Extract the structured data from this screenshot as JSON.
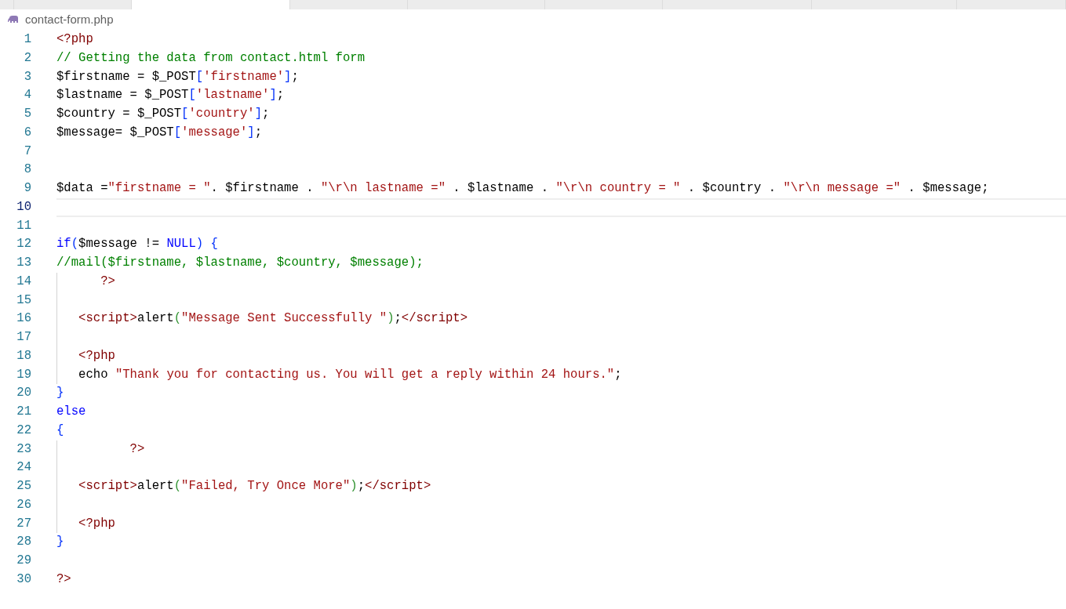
{
  "tabs": [
    {
      "selected": false
    },
    {
      "selected": false
    },
    {
      "selected": true
    },
    {
      "selected": false
    },
    {
      "selected": false
    },
    {
      "selected": false
    },
    {
      "selected": false
    },
    {
      "selected": false
    },
    {
      "selected": false
    }
  ],
  "breadcrumb": {
    "file": "contact-form.php"
  },
  "lines": [
    {
      "number": "1",
      "current": false,
      "guide": false,
      "tokens": [
        {
          "kind": "tag",
          "text": "<?php"
        }
      ]
    },
    {
      "number": "2",
      "current": false,
      "guide": false,
      "tokens": [
        {
          "kind": "comment",
          "text": "// Getting the data from contact.html form"
        }
      ]
    },
    {
      "number": "3",
      "current": false,
      "guide": false,
      "tokens": [
        {
          "kind": "plain",
          "text": "$firstname = $_POST"
        },
        {
          "kind": "bracket",
          "text": "["
        },
        {
          "kind": "string",
          "text": "'firstname'"
        },
        {
          "kind": "bracket",
          "text": "]"
        },
        {
          "kind": "plain",
          "text": ";"
        }
      ]
    },
    {
      "number": "4",
      "current": false,
      "guide": false,
      "tokens": [
        {
          "kind": "plain",
          "text": "$lastname = $_POST"
        },
        {
          "kind": "bracket",
          "text": "["
        },
        {
          "kind": "string",
          "text": "'lastname'"
        },
        {
          "kind": "bracket",
          "text": "]"
        },
        {
          "kind": "plain",
          "text": ";"
        }
      ]
    },
    {
      "number": "5",
      "current": false,
      "guide": false,
      "tokens": [
        {
          "kind": "plain",
          "text": "$country = $_POST"
        },
        {
          "kind": "bracket",
          "text": "["
        },
        {
          "kind": "string",
          "text": "'country'"
        },
        {
          "kind": "bracket",
          "text": "]"
        },
        {
          "kind": "plain",
          "text": ";"
        }
      ]
    },
    {
      "number": "6",
      "current": false,
      "guide": false,
      "tokens": [
        {
          "kind": "plain",
          "text": "$message= $_POST"
        },
        {
          "kind": "bracket",
          "text": "["
        },
        {
          "kind": "string",
          "text": "'message'"
        },
        {
          "kind": "bracket",
          "text": "]"
        },
        {
          "kind": "plain",
          "text": ";"
        }
      ]
    },
    {
      "number": "7",
      "current": false,
      "guide": false
    },
    {
      "number": "8",
      "current": false,
      "guide": false
    },
    {
      "number": "9",
      "current": false,
      "guide": false,
      "tokens": [
        {
          "kind": "plain",
          "text": "$data ="
        },
        {
          "kind": "string",
          "text": "\"firstname = \""
        },
        {
          "kind": "plain",
          "text": ". $firstname . "
        },
        {
          "kind": "string",
          "text": "\"\\r\\n lastname =\""
        },
        {
          "kind": "plain",
          "text": " . $lastname . "
        },
        {
          "kind": "string",
          "text": "\"\\r\\n country = \""
        },
        {
          "kind": "plain",
          "text": " . $country . "
        },
        {
          "kind": "string",
          "text": "\"\\r\\n message =\""
        },
        {
          "kind": "plain",
          "text": " . $message;"
        }
      ]
    },
    {
      "number": "10",
      "current": true,
      "guide": false
    },
    {
      "number": "11",
      "current": false,
      "guide": false
    },
    {
      "number": "12",
      "current": false,
      "guide": false,
      "tokens": [
        {
          "kind": "keyword",
          "text": "if"
        },
        {
          "kind": "bracket",
          "text": "("
        },
        {
          "kind": "plain",
          "text": "$message != "
        },
        {
          "kind": "keyword",
          "text": "NULL"
        },
        {
          "kind": "bracket",
          "text": ") {"
        }
      ]
    },
    {
      "number": "13",
      "current": false,
      "guide": false,
      "tokens": [
        {
          "kind": "comment",
          "text": "//mail($firstname, $lastname, $country, $message);"
        }
      ]
    },
    {
      "number": "14",
      "current": false,
      "guide": true,
      "tokens": [
        {
          "kind": "tag",
          "text": "      ?>"
        }
      ]
    },
    {
      "number": "15",
      "current": false,
      "guide": true
    },
    {
      "number": "16",
      "current": false,
      "guide": true,
      "tokens": [
        {
          "kind": "tag",
          "text": "   <script>"
        },
        {
          "kind": "plain",
          "text": "alert"
        },
        {
          "kind": "paren",
          "text": "("
        },
        {
          "kind": "string",
          "text": "\"Message Sent Successfully \""
        },
        {
          "kind": "paren",
          "text": ")"
        },
        {
          "kind": "plain",
          "text": ";"
        },
        {
          "kind": "tag",
          "text": "</script>"
        }
      ]
    },
    {
      "number": "17",
      "current": false,
      "guide": true
    },
    {
      "number": "18",
      "current": false,
      "guide": true,
      "tokens": [
        {
          "kind": "tag",
          "text": "   <?php"
        }
      ]
    },
    {
      "number": "19",
      "current": false,
      "guide": true,
      "tokens": [
        {
          "kind": "plain",
          "text": "   echo "
        },
        {
          "kind": "string",
          "text": "\"Thank you for contacting us. You will get a reply within 24 hours.\""
        },
        {
          "kind": "plain",
          "text": ";"
        }
      ]
    },
    {
      "number": "20",
      "current": false,
      "guide": false,
      "tokens": [
        {
          "kind": "bracket",
          "text": "}"
        }
      ]
    },
    {
      "number": "21",
      "current": false,
      "guide": false,
      "tokens": [
        {
          "kind": "keyword",
          "text": "else"
        }
      ]
    },
    {
      "number": "22",
      "current": false,
      "guide": false,
      "tokens": [
        {
          "kind": "bracket",
          "text": "{"
        }
      ]
    },
    {
      "number": "23",
      "current": false,
      "guide": true,
      "tokens": [
        {
          "kind": "tag",
          "text": "          ?>"
        }
      ]
    },
    {
      "number": "24",
      "current": false,
      "guide": true
    },
    {
      "number": "25",
      "current": false,
      "guide": true,
      "tokens": [
        {
          "kind": "tag",
          "text": "   <script>"
        },
        {
          "kind": "plain",
          "text": "alert"
        },
        {
          "kind": "paren",
          "text": "("
        },
        {
          "kind": "string",
          "text": "\"Failed, Try Once More\""
        },
        {
          "kind": "paren",
          "text": ")"
        },
        {
          "kind": "plain",
          "text": ";"
        },
        {
          "kind": "tag",
          "text": "</script>"
        }
      ]
    },
    {
      "number": "26",
      "current": false,
      "guide": true
    },
    {
      "number": "27",
      "current": false,
      "guide": true,
      "tokens": [
        {
          "kind": "tag",
          "text": "   <?php"
        }
      ]
    },
    {
      "number": "28",
      "current": false,
      "guide": false,
      "tokens": [
        {
          "kind": "bracket",
          "text": "}"
        }
      ]
    },
    {
      "number": "29",
      "current": false,
      "guide": false
    },
    {
      "number": "30",
      "current": false,
      "guide": false,
      "tokens": [
        {
          "kind": "tag",
          "text": "?>"
        }
      ]
    }
  ]
}
